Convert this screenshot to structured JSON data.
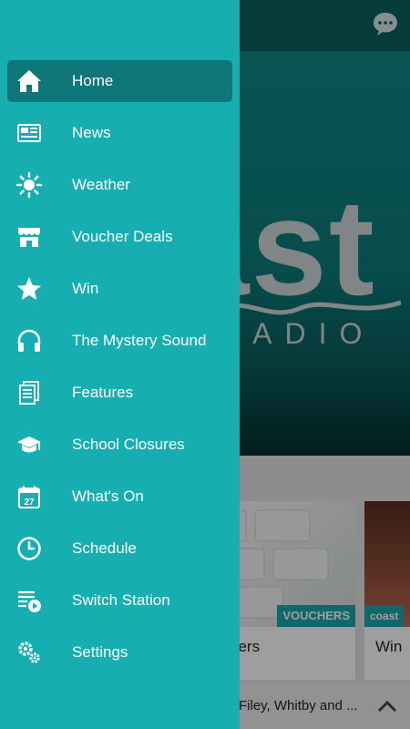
{
  "drawer": {
    "items": [
      {
        "label": "Home",
        "icon": "home-icon",
        "active": true
      },
      {
        "label": "News",
        "icon": "newspaper-icon",
        "active": false
      },
      {
        "label": "Weather",
        "icon": "sun-icon",
        "active": false
      },
      {
        "label": "Voucher Deals",
        "icon": "store-icon",
        "active": false
      },
      {
        "label": "Win",
        "icon": "star-icon",
        "active": false
      },
      {
        "label": "The Mystery Sound",
        "icon": "headphones-icon",
        "active": false
      },
      {
        "label": "Features",
        "icon": "documents-icon",
        "active": false
      },
      {
        "label": "School Closures",
        "icon": "graduation-cap-icon",
        "active": false
      },
      {
        "label": "What's On",
        "icon": "calendar-icon",
        "active": false
      },
      {
        "label": "Schedule",
        "icon": "clock-icon",
        "active": false
      },
      {
        "label": "Switch Station",
        "icon": "playlist-play-icon",
        "active": false
      },
      {
        "label": "Settings",
        "icon": "gears-icon",
        "active": false
      }
    ],
    "calendar_day": "27"
  },
  "background": {
    "hero_word": "ast",
    "hero_sub": "RADIO",
    "cards": [
      {
        "tag": "VOUCHERS",
        "title": "ners"
      },
      {
        "tag": "coast",
        "title": "Win"
      }
    ],
    "bottom_text": "Filey, Whitby and ..."
  },
  "colors": {
    "drawer_bg": "#17aeb2",
    "active_item_bg": "#0f7679",
    "accent": "#1aa9ae"
  }
}
